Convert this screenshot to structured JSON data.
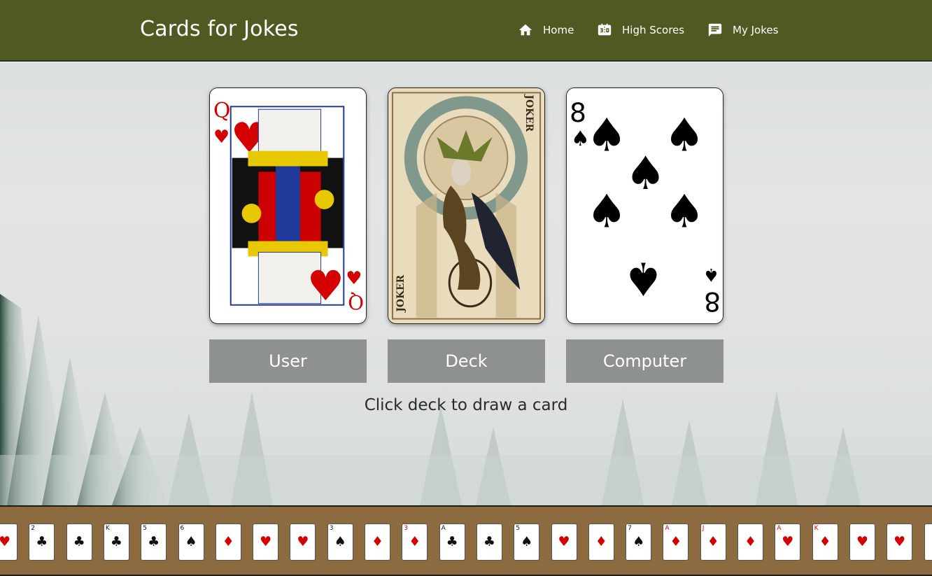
{
  "header": {
    "brand": "Cards for Jokes",
    "nav": [
      {
        "label": "Home",
        "icon": "home-icon"
      },
      {
        "label": "High Scores",
        "icon": "scoreboard-icon"
      },
      {
        "label": "My Jokes",
        "icon": "comment-icon"
      }
    ]
  },
  "cards": {
    "user": {
      "rank": "Q",
      "suit": "hearts",
      "label": "User"
    },
    "deck": {
      "image": "joker-card",
      "text": "JOKER",
      "label": "Deck"
    },
    "computer": {
      "rank": "8",
      "suit": "spades",
      "label": "Computer"
    }
  },
  "instruction": "Click deck to draw a card",
  "footer_cards": [
    {
      "rank": "",
      "suit": "♥",
      "color": "red"
    },
    {
      "rank": "2",
      "suit": "♣",
      "color": "blk"
    },
    {
      "rank": "",
      "suit": "♣",
      "color": "blk"
    },
    {
      "rank": "K",
      "suit": "♣",
      "color": "blk"
    },
    {
      "rank": "5",
      "suit": "♣",
      "color": "blk"
    },
    {
      "rank": "6",
      "suit": "♠",
      "color": "blk"
    },
    {
      "rank": "",
      "suit": "♦",
      "color": "red"
    },
    {
      "rank": "",
      "suit": "♥",
      "color": "red"
    },
    {
      "rank": "",
      "suit": "♥",
      "color": "red"
    },
    {
      "rank": "3",
      "suit": "♠",
      "color": "blk"
    },
    {
      "rank": "",
      "suit": "♦",
      "color": "red"
    },
    {
      "rank": "3",
      "suit": "♦",
      "color": "red"
    },
    {
      "rank": "A",
      "suit": "♣",
      "color": "blk"
    },
    {
      "rank": "",
      "suit": "♣",
      "color": "blk"
    },
    {
      "rank": "5",
      "suit": "♠",
      "color": "blk"
    },
    {
      "rank": "",
      "suit": "♥",
      "color": "red"
    },
    {
      "rank": "",
      "suit": "♦",
      "color": "red"
    },
    {
      "rank": "7",
      "suit": "♠",
      "color": "blk"
    },
    {
      "rank": "A",
      "suit": "♦",
      "color": "red"
    },
    {
      "rank": "J",
      "suit": "♦",
      "color": "red"
    },
    {
      "rank": "",
      "suit": "♦",
      "color": "red"
    },
    {
      "rank": "A",
      "suit": "♥",
      "color": "red"
    },
    {
      "rank": "K",
      "suit": "♦",
      "color": "red"
    },
    {
      "rank": "",
      "suit": "♥",
      "color": "red"
    },
    {
      "rank": "",
      "suit": "♥",
      "color": "red"
    },
    {
      "rank": "",
      "suit": "♥",
      "color": "red"
    }
  ],
  "colors": {
    "navbar": "#4f5a22",
    "footer": "#8c6b40",
    "button": "#808282"
  }
}
